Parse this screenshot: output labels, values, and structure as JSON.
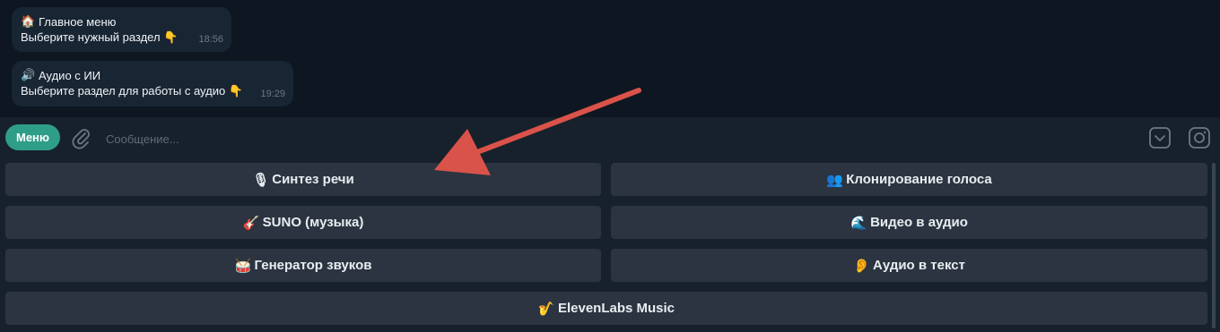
{
  "messages": [
    {
      "icon": "🏠",
      "icon_name": "house-icon",
      "title": "Главное меню",
      "body": "Выберите нужный раздел",
      "body_emoji": "👇",
      "time": "18:56"
    },
    {
      "icon": "🔊",
      "icon_name": "speaker-icon",
      "title": "Аудио с ИИ",
      "body": "Выберите раздел для работы с аудио",
      "body_emoji": "👇",
      "time": "19:29"
    }
  ],
  "composer": {
    "menu_label": "Меню",
    "placeholder": "Сообщение..."
  },
  "keyboard": {
    "buttons": [
      {
        "icon": "🎙",
        "icon_name": "microphone-icon",
        "label": "Синтез речи"
      },
      {
        "icon": "👥",
        "icon_name": "people-icon",
        "label": "Клонирование голоса"
      },
      {
        "icon": "🎸",
        "icon_name": "guitar-icon",
        "label": "SUNO (музыка)"
      },
      {
        "icon": "🌊",
        "icon_name": "wave-icon",
        "label": "Видео в аудио"
      },
      {
        "icon": "🥁",
        "icon_name": "drum-icon",
        "label": "Генератор звуков"
      },
      {
        "icon": "👂",
        "icon_name": "ear-icon",
        "label": "Аудио в текст"
      },
      {
        "icon": "🎷",
        "icon_name": "saxophone-icon",
        "label": "ElevenLabs Music"
      }
    ]
  },
  "colors": {
    "chat_bg": "#0e1621",
    "panel_bg": "#17212b",
    "bubble_bg": "#182533",
    "button_bg": "#2b3440",
    "menu_accent": "#2f9e88",
    "annotation_arrow": "#d9534a"
  }
}
